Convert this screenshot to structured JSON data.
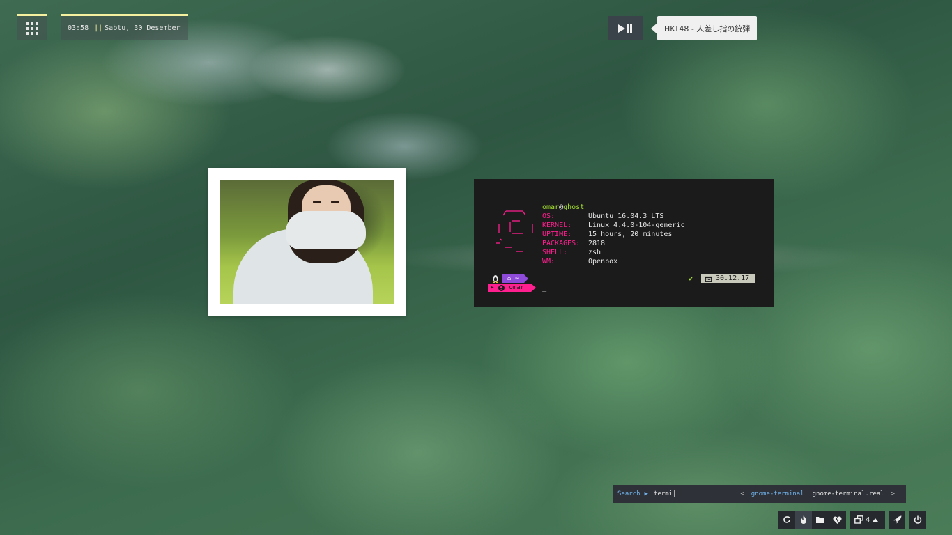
{
  "topbar": {
    "clock_time": "03:58",
    "clock_sep": "||",
    "clock_date": "Sabtu, 30 Desember"
  },
  "music": {
    "now_playing": "HKT48 - 人差し指の銃弾"
  },
  "terminal": {
    "user": "omar",
    "at": "@",
    "host": "ghost",
    "info": [
      {
        "key": "OS:",
        "value": "Ubuntu 16.04.3 LTS"
      },
      {
        "key": "KERNEL:",
        "value": "Linux 4.4.0-104-generic"
      },
      {
        "key": "UPTIME:",
        "value": "15 hours, 20 minutes"
      },
      {
        "key": "PACKAGES:",
        "value": "2818"
      },
      {
        "key": "SHELL:",
        "value": "zsh"
      },
      {
        "key": "WM:",
        "value": "Openbox"
      }
    ],
    "prompt_dir": "~",
    "prompt_user": "omar",
    "cursor": "_",
    "date": "30.12.17"
  },
  "launcher": {
    "label": "Search",
    "query": "termi|",
    "prev": "<",
    "next": ">",
    "results": [
      "gnome-terminal",
      "gnome-terminal.real"
    ]
  },
  "tray": {
    "workspace_count": "4"
  },
  "colors": {
    "accent_yellow": "#f4f0a0",
    "term_pink": "#ff1f8f",
    "term_green": "#a6e22e",
    "term_purple": "#8e4ad8",
    "launcher_blue": "#6fb0e8"
  }
}
